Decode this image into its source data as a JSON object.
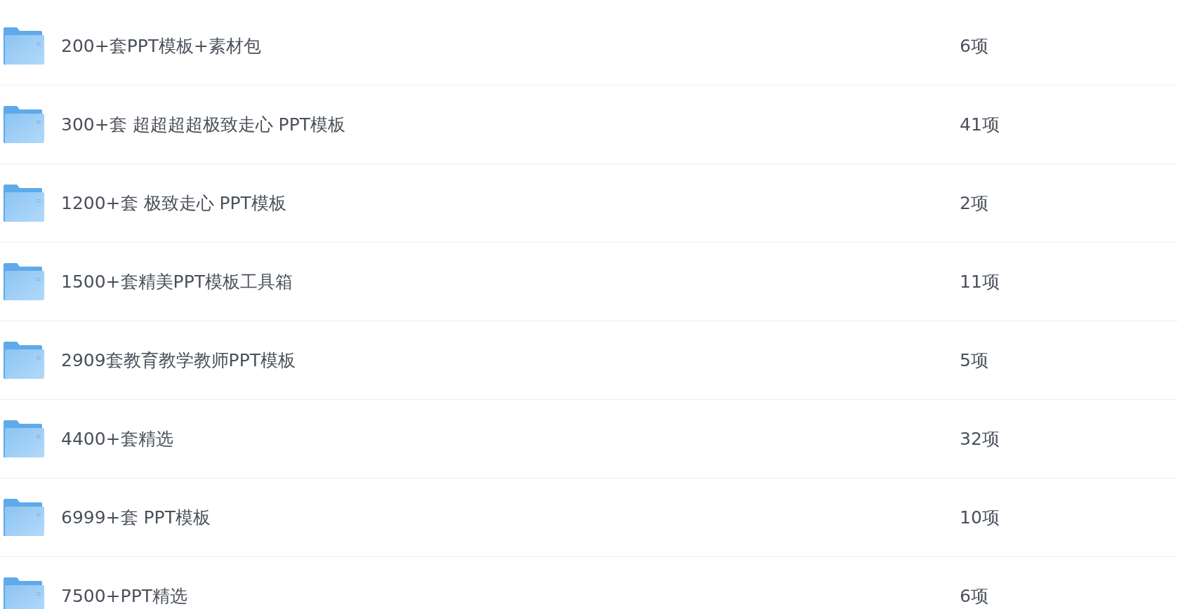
{
  "folders": [
    {
      "name": "200+套PPT模板+素材包",
      "count": "6项"
    },
    {
      "name": "300+套 超超超超极致走心 PPT模板",
      "count": "41项"
    },
    {
      "name": "1200+套 极致走心 PPT模板",
      "count": "2项"
    },
    {
      "name": "1500+套精美PPT模板工具箱",
      "count": "11项"
    },
    {
      "name": "2909套教育教学教师PPT模板",
      "count": "5项"
    },
    {
      "name": "4400+套精选",
      "count": "32项"
    },
    {
      "name": "6999+套 PPT模板",
      "count": "10项"
    },
    {
      "name": "7500+PPT精选",
      "count": "6项"
    }
  ]
}
